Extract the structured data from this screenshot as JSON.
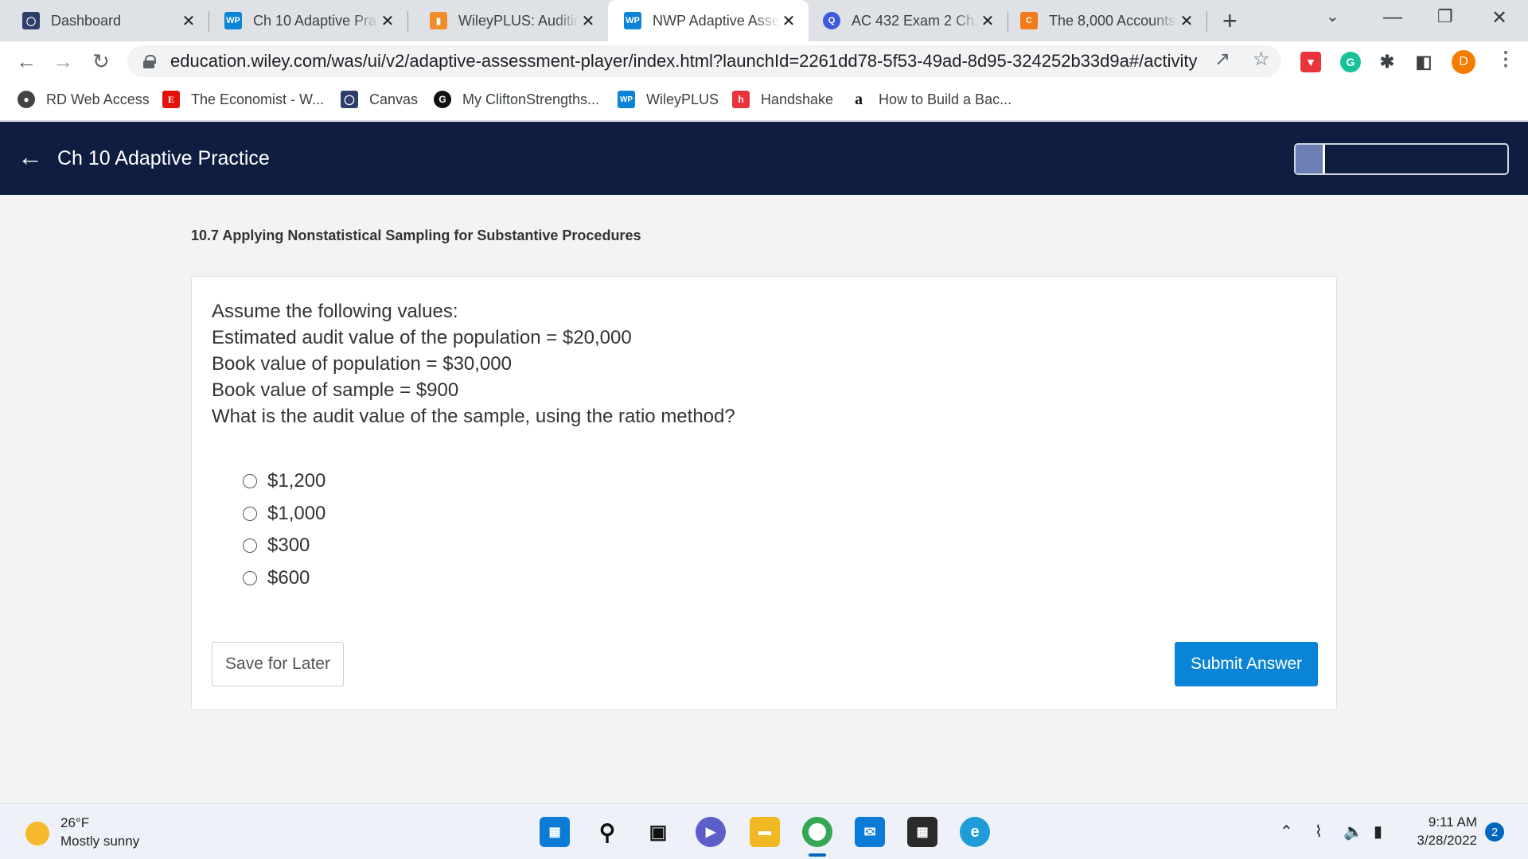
{
  "browser": {
    "tabs": [
      {
        "title": "Dashboard",
        "favicon": "shield-icon",
        "fav_color": "#2d3e6b"
      },
      {
        "title": "Ch 10 Adaptive Pra",
        "favicon": "wp-icon",
        "fav_color": "#0a84d6"
      },
      {
        "title": "WileyPLUS: Auditin",
        "favicon": "bookmark-icon",
        "fav_color": "#f28c28"
      },
      {
        "title": "NWP Adaptive Asse",
        "favicon": "wp-icon",
        "fav_color": "#0a84d6"
      },
      {
        "title": "AC 432 Exam 2 Ch.",
        "favicon": "search-icon",
        "fav_color": "#3b5bdb"
      },
      {
        "title": "The 8,000 Accounts",
        "favicon": "c-icon",
        "fav_color": "#f27a1a"
      }
    ],
    "url": "education.wiley.com/was/ui/v2/adaptive-assessment-player/index.html?launchId=2261dd78-5f53-49ad-8d95-324252b33d9a#/activity",
    "profile_initial": "D",
    "bookmarks": [
      {
        "label": "RD Web Access",
        "favicon": "globe-icon",
        "fav_color": "#444"
      },
      {
        "label": "The Economist - W...",
        "favicon": "economist-icon",
        "fav_color": "#e3120b",
        "fav_text": "E"
      },
      {
        "label": "Canvas",
        "favicon": "shield-icon",
        "fav_color": "#2d3e6b"
      },
      {
        "label": "My CliftonStrengths...",
        "favicon": "gallup-icon",
        "fav_color": "#111",
        "fav_text": "G"
      },
      {
        "label": "WileyPLUS",
        "favicon": "wp-icon",
        "fav_color": "#0a84d6",
        "fav_text": "WP"
      },
      {
        "label": "Handshake",
        "favicon": "handshake-icon",
        "fav_color": "#e8343a",
        "fav_text": "h"
      },
      {
        "label": "How to Build a Bac...",
        "favicon": "a-icon",
        "fav_color": "#fff",
        "fav_text": "a"
      }
    ]
  },
  "app": {
    "title": "Ch 10 Adaptive Practice",
    "progress_fraction": 0.14
  },
  "question": {
    "section": "10.7 Applying Nonstatistical Sampling for Substantive Procedures",
    "lines": [
      "Assume the following values:",
      "Estimated audit value of the population = $20,000",
      "Book value of population = $30,000",
      "Book value of sample = $900",
      "What is the audit value of the sample, using the ratio method?"
    ],
    "options": [
      "$1,200",
      "$1,000",
      "$300",
      "$600"
    ],
    "save_label": "Save for Later",
    "submit_label": "Submit Answer"
  },
  "taskbar": {
    "temperature": "26°F",
    "weather": "Mostly sunny",
    "time": "9:11 AM",
    "date": "3/28/2022",
    "notifications": "2"
  }
}
